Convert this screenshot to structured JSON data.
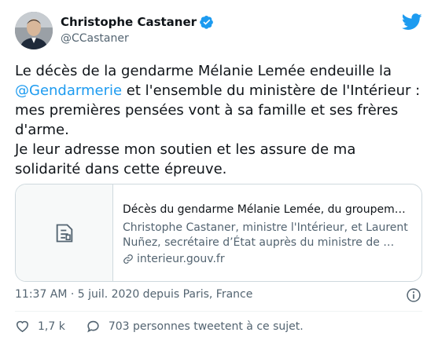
{
  "author": {
    "name": "Christophe Castaner",
    "handle": "@CCastaner",
    "verified": true
  },
  "tweet": {
    "text_part1": "Le décès de la gendarme Mélanie Lemée endeuille la ",
    "mention": "@Gendarmerie",
    "text_part2": " et l'ensemble du ministère de l'Intérieur : mes premières pensées vont à sa famille et ses frères d'arme.",
    "text_part3": "Je leur adresse mon soutien et les assure de ma solidarité dans cette épreuve."
  },
  "link_preview": {
    "title": "Décès du gendarme Mélanie Lemée, du groupement…",
    "description": "Christophe Castaner, ministre l'Intérieur, et Laurent Nuñez, secrétaire d’État auprès du ministre de …",
    "domain": "interieur.gouv.fr"
  },
  "meta": {
    "timestamp": "11:37 AM · 5 juil. 2020 depuis Paris, France"
  },
  "engagement": {
    "likes": "1,7 k",
    "conversation": "703 personnes tweetent à ce sujet."
  },
  "colors": {
    "accent": "#1d9bf0",
    "text": "#0f1419",
    "secondary": "#536471",
    "border": "#cfd9de"
  },
  "icons": [
    "verified-badge-icon",
    "twitter-bird-icon",
    "document-icon",
    "link-icon",
    "info-icon",
    "heart-icon",
    "speech-bubble-icon"
  ]
}
